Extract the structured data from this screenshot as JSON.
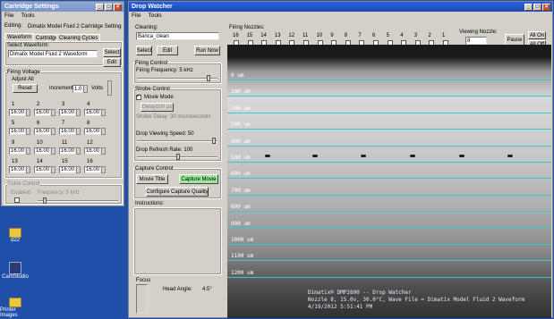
{
  "desktop": {
    "icons": [
      {
        "label": "d22"
      },
      {
        "label": "CamStudio"
      },
      {
        "label": "Printer Images"
      }
    ]
  },
  "cartridge": {
    "title": "Cartridge Settings",
    "menu": [
      "File",
      "Tools"
    ],
    "editing_label": "Editing:",
    "editing_value": "Dimatix Model Fluid 2 Cartridge Settings",
    "tabs": [
      "Waveform",
      "Cartridge",
      "Cleaning Cycles"
    ],
    "select_wave_label": "Select Waveform:",
    "wave_value": "Dimatix Model Fluid 2 Waveform",
    "select": "Select",
    "edit": "Edit",
    "fv_label": "Firing Voltage",
    "adjust_all": "Adjust All",
    "reset": "Reset",
    "increment_label": "Increment:",
    "increment_value": "1.0",
    "volts": "Volts",
    "nozzles": [
      {
        "n": "1",
        "v": "16.00"
      },
      {
        "n": "2",
        "v": "16.00"
      },
      {
        "n": "3",
        "v": "16.00"
      },
      {
        "n": "4",
        "v": "16.00"
      },
      {
        "n": "5",
        "v": "16.00"
      },
      {
        "n": "6",
        "v": "16.00"
      },
      {
        "n": "7",
        "v": "16.00"
      },
      {
        "n": "8",
        "v": "16.00"
      },
      {
        "n": "9",
        "v": "16.00"
      },
      {
        "n": "10",
        "v": "16.00"
      },
      {
        "n": "11",
        "v": "16.00"
      },
      {
        "n": "12",
        "v": "16.00"
      },
      {
        "n": "13",
        "v": "16.00"
      },
      {
        "n": "14",
        "v": "16.00"
      },
      {
        "n": "15",
        "v": "16.00"
      },
      {
        "n": "16",
        "v": "16.00"
      }
    ],
    "tickle_label": "Tickle Control",
    "enabled": "Enabled",
    "frequency": "Frequency: 5 kHz"
  },
  "dropwatcher": {
    "title": "Drop Watcher",
    "menu": [
      "File",
      "Tools"
    ],
    "cleaning_label": "Cleaning:",
    "cleaning_value": "Banca_clean",
    "select": "Select",
    "edit": "Edit",
    "run_now": "Run Now",
    "firing_nozzles_label": "Firing Nozzles:",
    "nozzle_numbers": [
      "16",
      "15",
      "14",
      "13",
      "12",
      "11",
      "10",
      "9",
      "8",
      "7",
      "6",
      "5",
      "4",
      "3",
      "2",
      "1"
    ],
    "viewing_nozzle_label": "Viewing Nozzle:",
    "viewing_nozzle_value": "8",
    "pause": "Pause",
    "all_on": "All On",
    "all_off": "All Off",
    "firing_control": "Firing Control",
    "firing_freq": "Firing Frequency: 5 kHz",
    "strobe_control": "Strobe Control",
    "movie_mode": "Movie Mode",
    "delay_btn": "Delay100 µs",
    "strobe_delay": "Strobe Delay: 30 microseconds",
    "drop_speed": "Drop Viewing Speed: 50",
    "refresh_rate": "Drop Refresh Rate: 100",
    "capture_control": "Capture Control",
    "movie_title": "Movie Title",
    "capture_movie": "Capture Movie",
    "configure_capture": "Configure Capture Quality",
    "instructions": "Instructions:",
    "focus": "Focus",
    "head_angle_label": "Head Angle:",
    "head_angle_value": "4.5°",
    "grid": [
      "0 um",
      "100 um",
      "200 um",
      "300 um",
      "400 um",
      "500 um",
      "600 um",
      "700 um",
      "800 um",
      "900 um",
      "1000 um",
      "1100 um",
      "1200 um"
    ],
    "overlay": [
      "Dimatix® DMP2800 -- Drop Watcher",
      "Nozzle 8, 15.0v, 30.0°C, Wave File = Dimatix Model Fluid 2 Waveform",
      "4/19/2012 5:51:41 PM"
    ]
  }
}
